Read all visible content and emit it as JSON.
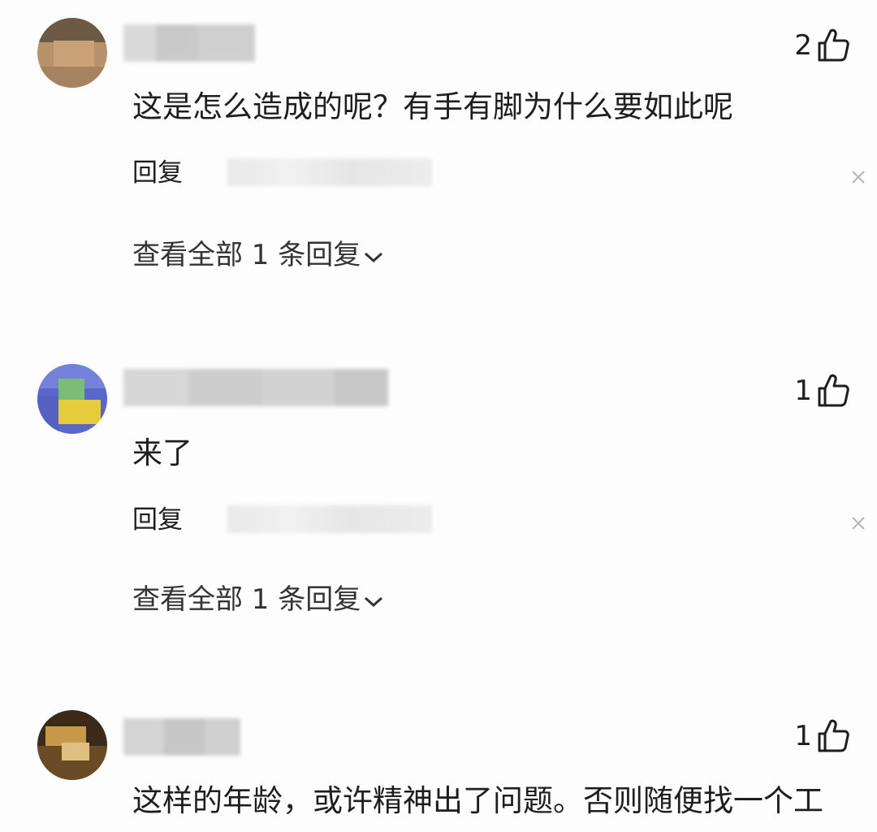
{
  "comments": [
    {
      "text": "这是怎么造成的呢？有手有脚为什么要如此呢",
      "likes": "2",
      "reply_label": "回复",
      "view_all": "查看全部 1 条回复"
    },
    {
      "text": "来了",
      "likes": "1",
      "reply_label": "回复",
      "view_all": "查看全部 1 条回复"
    },
    {
      "text": "这样的年龄，或许精神出了问题。否则随便找一个工",
      "likes": "1"
    }
  ],
  "icons": {
    "like": "thumbs-up-outline-icon",
    "close": "close-x-icon",
    "expand": "chevron-down-icon"
  }
}
